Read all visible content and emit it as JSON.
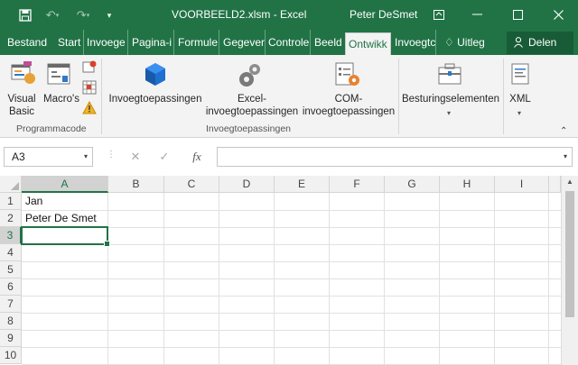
{
  "window": {
    "title": "VOORBEELD2.xlsm - Excel",
    "user": "Peter DeSmet",
    "colors": {
      "accent": "#217346",
      "share": "#185c37",
      "ribbon": "#f3f3f3"
    }
  },
  "quick_access": [
    {
      "icon": "save-icon"
    },
    {
      "icon": "undo-icon"
    },
    {
      "icon": "redo-icon"
    },
    {
      "icon": "customize-qa-icon"
    }
  ],
  "window_buttons": [
    {
      "icon": "ribbon-display-options-icon"
    },
    {
      "icon": "minimize-icon"
    },
    {
      "icon": "maximize-icon"
    },
    {
      "icon": "close-icon"
    }
  ],
  "tabs": [
    {
      "label": "Bestand"
    },
    {
      "label": "Start"
    },
    {
      "label": "Invoege"
    },
    {
      "label": "Pagina-i"
    },
    {
      "label": "Formule"
    },
    {
      "label": "Gegever"
    },
    {
      "label": "Controle"
    },
    {
      "label": "Beeld"
    },
    {
      "label": "Ontwikk",
      "active": true
    },
    {
      "label": "Invoegtc"
    }
  ],
  "tell_me": "Uitleg",
  "share": "Delen",
  "ribbon": {
    "code_group": {
      "visual_basic": "Visual\nBasic",
      "macros": "Macro's",
      "label": "Programmacode"
    },
    "addins_group": {
      "addins": "Invoegtoepassingen",
      "excel_addins": "Excel-\ninvoegtoepassingen",
      "com_addins": "COM-\ninvoegtoepassingen",
      "label": "Invoegtoepassingen"
    },
    "controls": "Besturingselementen",
    "xml": "XML"
  },
  "formula_bar": {
    "name_box": "A3",
    "cancel": "✕",
    "enter": "✓",
    "fx": "fx",
    "value": ""
  },
  "sheet": {
    "columns": [
      "A",
      "B",
      "C",
      "D",
      "E",
      "F",
      "G",
      "H",
      "I"
    ],
    "rows": [
      "1",
      "2",
      "3",
      "4",
      "5",
      "6",
      "7",
      "8",
      "9",
      "10"
    ],
    "cells": {
      "A1": "Jan",
      "A2": "Peter De Smet"
    },
    "selected": "A3"
  }
}
